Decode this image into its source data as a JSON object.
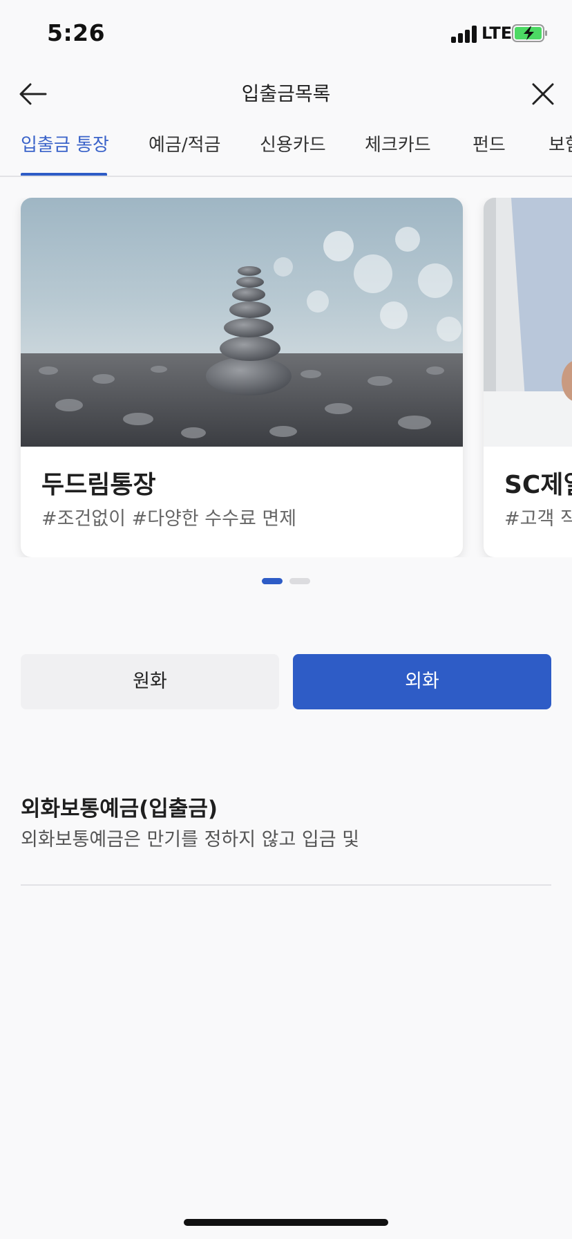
{
  "status_bar": {
    "time": "5:26",
    "network": "LTE"
  },
  "header": {
    "title": "입출금목록"
  },
  "tabs": [
    {
      "label": "입출금 통장",
      "active": true
    },
    {
      "label": "예금/적금",
      "active": false
    },
    {
      "label": "신용카드",
      "active": false
    },
    {
      "label": "체크카드",
      "active": false
    },
    {
      "label": "펀드",
      "active": false
    },
    {
      "label": "보험",
      "active": false
    }
  ],
  "carousel": {
    "cards": [
      {
        "title": "두드림통장",
        "tags": "#조건없이 #다양한 수수료 면제",
        "image": "stacked-stones-beach-photo"
      },
      {
        "title": "SC제일",
        "tags": "#고객 직",
        "image": "business-person-photo"
      }
    ],
    "page_count": 2,
    "current_page": 1
  },
  "currency_toggle": {
    "krw_label": "원화",
    "fx_label": "외화",
    "selected": "외화"
  },
  "products": [
    {
      "name": "외화보통예금(입출금)",
      "description": "외화보통예금은 만기를 정하지 않고 입금 및"
    }
  ],
  "colors": {
    "accent": "#2e5cc6",
    "background": "#f9f9fa",
    "divider": "#e2e2e5"
  }
}
